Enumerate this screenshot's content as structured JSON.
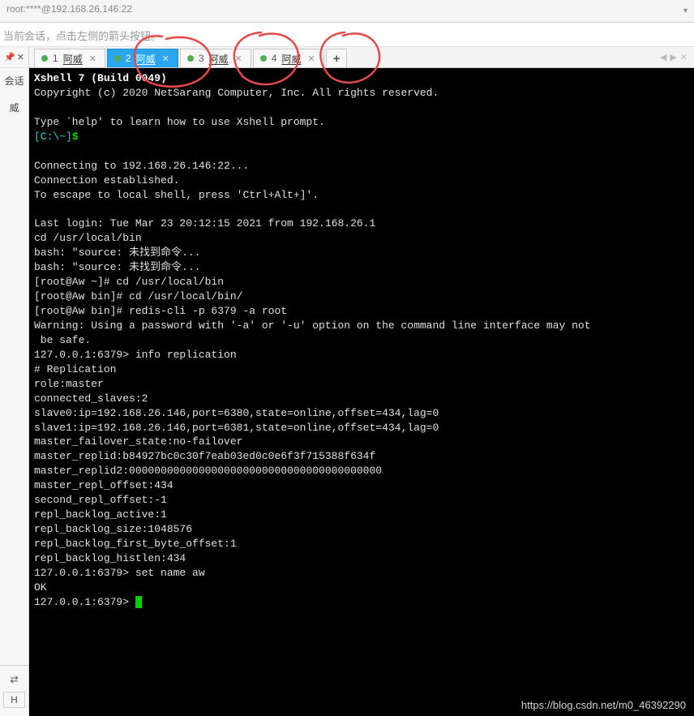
{
  "titlebar": {
    "text": "root:****@192.168.26.146:22"
  },
  "hintbar": {
    "text": "当前会话，点击左侧的箭头按钮。"
  },
  "left_panel": {
    "pin": "📌",
    "close": "✕",
    "text1": "会话",
    "text2": "威",
    "arrows": "⇄",
    "letter": "H"
  },
  "tabs": [
    {
      "num": "1",
      "label": "阿威",
      "active": false
    },
    {
      "num": "2",
      "label": "阿威",
      "active": true
    },
    {
      "num": "3",
      "label": "阿威",
      "active": false
    },
    {
      "num": "4",
      "label": "阿威",
      "active": false
    }
  ],
  "newtab": "+",
  "nav": {
    "left": "◀",
    "right": "▶",
    "close": "✕"
  },
  "terminal": {
    "l01": "Xshell 7 (Build 0049)",
    "l02": "Copyright (c) 2020 NetSarang Computer, Inc. All rights reserved.",
    "l03": "",
    "l04": "Type `help' to learn how to use Xshell prompt.",
    "l05a": "[C:\\~]",
    "l05b": "$",
    "l06": "",
    "l07": "Connecting to 192.168.26.146:22...",
    "l08": "Connection established.",
    "l09": "To escape to local shell, press 'Ctrl+Alt+]'.",
    "l10": "",
    "l11": "Last login: Tue Mar 23 20:12:15 2021 from 192.168.26.1",
    "l12": "cd /usr/local/bin",
    "l13": "bash: \"source: 未找到命令...",
    "l14": "bash: \"source: 未找到命令...",
    "l15": "[root@Aw ~]# cd /usr/local/bin",
    "l16": "[root@Aw bin]# cd /usr/local/bin/",
    "l17": "[root@Aw bin]# redis-cli -p 6379 -a root",
    "l18": "Warning: Using a password with '-a' or '-u' option on the command line interface may not",
    "l18b": " be safe.",
    "l19": "127.0.0.1:6379> info replication",
    "l20": "# Replication",
    "l21": "role:master",
    "l22": "connected_slaves:2",
    "l23": "slave0:ip=192.168.26.146,port=6380,state=online,offset=434,lag=0",
    "l24": "slave1:ip=192.168.26.146,port=6381,state=online,offset=434,lag=0",
    "l25": "master_failover_state:no-failover",
    "l26": "master_replid:b84927bc0c30f7eab03ed0c0e6f3f715388f634f",
    "l27": "master_replid2:0000000000000000000000000000000000000000",
    "l28": "master_repl_offset:434",
    "l29": "second_repl_offset:-1",
    "l30": "repl_backlog_active:1",
    "l31": "repl_backlog_size:1048576",
    "l32": "repl_backlog_first_byte_offset:1",
    "l33": "repl_backlog_histlen:434",
    "l34": "127.0.0.1:6379> set name aw",
    "l35": "OK",
    "l36": "127.0.0.1:6379> "
  },
  "watermark": "https://blog.csdn.net/m0_46392290"
}
